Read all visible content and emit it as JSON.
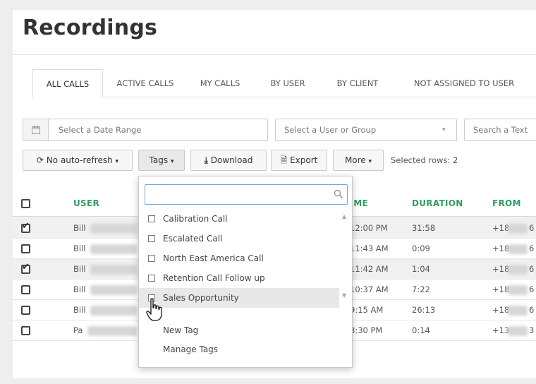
{
  "page_title": "Recordings",
  "tabs": [
    "ALL CALLS",
    "ACTIVE CALLS",
    "MY CALLS",
    "BY USER",
    "BY CLIENT",
    "NOT ASSIGNED TO USER"
  ],
  "filters": {
    "date_placeholder": "Select a Date Range",
    "user_group_placeholder": "Select a User or Group",
    "search_placeholder": "Search a Text"
  },
  "toolbar": {
    "auto_refresh": "No auto-refresh",
    "tags": "Tags",
    "download": "Download",
    "export": "Export",
    "more": "More",
    "selected_rows": "Selected rows: 2"
  },
  "table": {
    "headers": {
      "user": "USER",
      "time": "TIME",
      "duration": "DURATION",
      "from": "FROM"
    },
    "rows": [
      {
        "user": "Bill",
        "time": "12:00 PM",
        "duration": "31:58",
        "from_prefix": "+18",
        "from_suffix": "6",
        "selected": true
      },
      {
        "user": "Bill",
        "time": "11:43 AM",
        "duration": "0:09",
        "from_prefix": "+18",
        "from_suffix": "6",
        "selected": false
      },
      {
        "user": "Bill",
        "time": "11:42 AM",
        "duration": "1:04",
        "from_prefix": "+18",
        "from_suffix": "6",
        "selected": true
      },
      {
        "user": "Bill",
        "time": "10:37 AM",
        "duration": "7:22",
        "from_prefix": "+18",
        "from_suffix": "6",
        "selected": false
      },
      {
        "user": "Bill",
        "time": "9:15 AM",
        "duration": "26:13",
        "from_prefix": "+18",
        "from_suffix": "6",
        "selected": false
      },
      {
        "user": "Pa",
        "time": "8:30 PM",
        "duration": "0:14",
        "from_prefix": "+13",
        "from_suffix": "3",
        "selected": false
      }
    ]
  },
  "tags_dropdown": {
    "search_value": "",
    "items": [
      "Calibration Call",
      "Escalated Call",
      "North East America Call",
      "Retention Call Follow up",
      "Sales Opportunity"
    ],
    "hovered_index": 4,
    "new_tag": "New Tag",
    "manage_tags": "Manage Tags"
  },
  "colors": {
    "header_green": "#2f9e60",
    "link_blue": "#6fa8dc"
  }
}
